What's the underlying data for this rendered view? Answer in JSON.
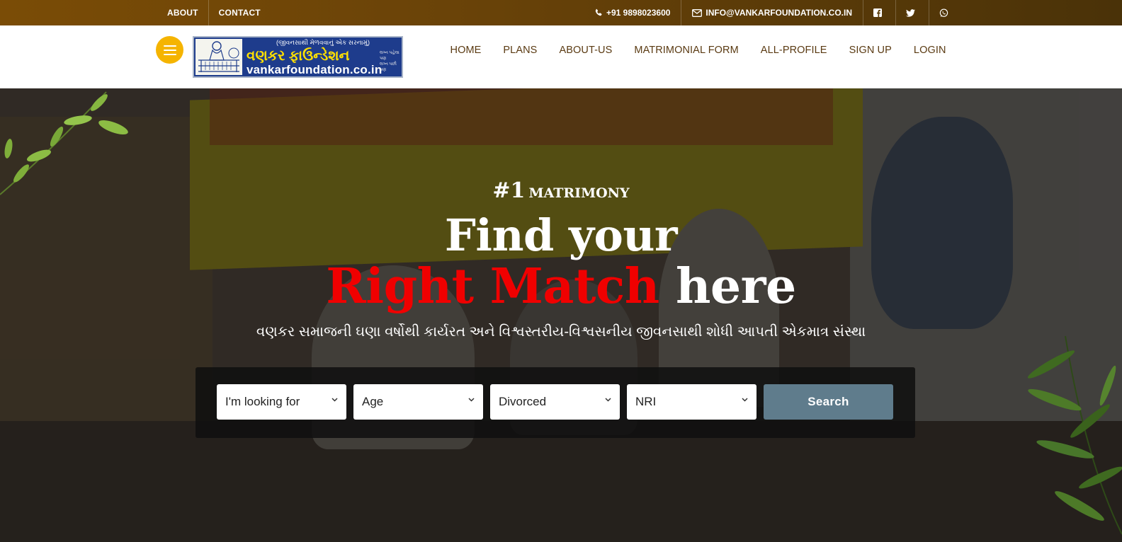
{
  "topbar": {
    "links": [
      "ABOUT",
      "CONTACT"
    ],
    "phone": "+91 9898023600",
    "email": "INFO@VANKARFOUNDATION.CO.IN",
    "social": [
      "facebook-icon",
      "twitter-icon",
      "whatsapp-icon"
    ]
  },
  "header": {
    "logo": {
      "tagline": "(જીવનસાથી મેળવવાનું એક સરનામું)",
      "name": "વણકર ફાઉન્ડેશન",
      "small_line1": "લગ્ન પહેલા પણ",
      "small_line2": "લગ્ન પછી પણ",
      "url": "vankarfoundation.co.in"
    },
    "nav": [
      "HOME",
      "PLANS",
      "ABOUT-US",
      "MATRIMONIAL FORM",
      "ALL-PROFILE",
      "SIGN UP",
      "LOGIN"
    ]
  },
  "hero": {
    "kicker_num": "#1",
    "kicker_word": "MATRIMONY",
    "line1": "Find your",
    "line2_highlight": "Right Match",
    "line2_rest": "here",
    "subtitle": "વણકર સમાજની ઘણા વર્ષોથી કાર્યરત અને વિશ્વસ્તરીય-વિશ્વસનીય જીવનસાથી શોધી આપતી એકમાત્ર સંસ્થા"
  },
  "search": {
    "looking_for": "I'm looking for",
    "age": "Age",
    "marital_status": "Divorced",
    "location": "NRI",
    "button": "Search"
  },
  "colors": {
    "topbar": "#6a4308",
    "accent_yellow": "#f5b400",
    "highlight_red": "#f00000",
    "nav_text": "#5a3a12",
    "search_button": "#5f7c8c"
  }
}
